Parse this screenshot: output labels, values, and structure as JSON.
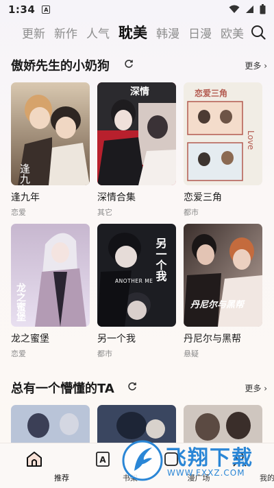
{
  "status_bar": {
    "time": "1:34",
    "notif_letter": "A"
  },
  "tabs": [
    {
      "label": "更新",
      "active": false
    },
    {
      "label": "新作",
      "active": false
    },
    {
      "label": "人气",
      "active": false
    },
    {
      "label": "耽美",
      "active": true
    },
    {
      "label": "韩漫",
      "active": false
    },
    {
      "label": "日漫",
      "active": false
    },
    {
      "label": "欧美",
      "active": false
    }
  ],
  "section1": {
    "title": "傲娇先生的小奶狗",
    "more": "更多",
    "cards": [
      {
        "title": "逢九年",
        "genre": "恋爱",
        "cover_text": "逢九年"
      },
      {
        "title": "深情合集",
        "genre": "其它",
        "cover_text": "深情"
      },
      {
        "title": "恋爱三角",
        "genre": "都市",
        "cover_text": "恋爱三角"
      },
      {
        "title": "龙之蜜堡",
        "genre": "恋爱",
        "cover_text": "龙之蜜堡"
      },
      {
        "title": "另一个我",
        "genre": "都市",
        "cover_text": "另一个我",
        "cover_subtitle": "ANOTHER ME"
      },
      {
        "title": "丹尼尔与黑帮",
        "genre": "悬疑",
        "cover_text": "丹尼尔与黑帮"
      }
    ]
  },
  "section2": {
    "title": "总有一个懵懂的TA",
    "more": "更多"
  },
  "bottom_nav": [
    {
      "label": "推荐",
      "icon": "home-icon",
      "active": true
    },
    {
      "label": "书架",
      "icon": "bookshelf-icon",
      "active": false
    },
    {
      "label": "漫广场",
      "icon": "plaza-icon",
      "active": false
    },
    {
      "label": "我的",
      "icon": "profile-icon",
      "active": false
    }
  ],
  "watermark": {
    "text": "飞翔下载",
    "url": "WWW.FXXZ.COM"
  },
  "colors": {
    "accent": "#2a86d6",
    "text_primary": "#1a1a1a",
    "text_secondary": "#8a8a8a"
  }
}
